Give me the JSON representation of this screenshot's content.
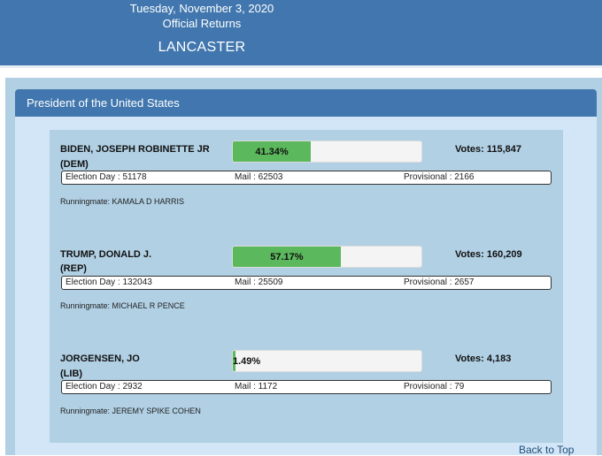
{
  "banner": {
    "date": "Tuesday, November 3, 2020",
    "returns": "Official Returns",
    "county": "LANCASTER"
  },
  "contest": {
    "title": "President of the United States"
  },
  "candidates": [
    {
      "name": "BIDEN, JOSEPH ROBINETTE JR",
      "party": "(DEM)",
      "percent": 41.34,
      "percent_label": "41.34%",
      "votes": "Votes: 115,847",
      "election_day": "Election Day : 51178",
      "mail": "Mail : 62503",
      "provisional": "Provisional : 2166",
      "runningmate": "Runningmate: KAMALA D HARRIS"
    },
    {
      "name": "TRUMP, DONALD J.",
      "party": "(REP)",
      "percent": 57.17,
      "percent_label": "57.17%",
      "votes": "Votes: 160,209",
      "election_day": "Election Day : 132043",
      "mail": "Mail : 25509",
      "provisional": "Provisional : 2657",
      "runningmate": "Runningmate: MICHAEL R PENCE"
    },
    {
      "name": "JORGENSEN, JO",
      "party": "(LIB)",
      "percent": 1.49,
      "percent_label": "1.49%",
      "votes": "Votes: 4,183",
      "election_day": "Election Day : 2932",
      "mail": "Mail : 1172",
      "provisional": "Provisional : 79",
      "runningmate": "Runningmate: JEREMY SPIKE COHEN"
    }
  ],
  "footer": {
    "back_to_top": "Back to Top"
  },
  "colors": {
    "header_blue": "#4177ae",
    "bar_green": "#5cb85c",
    "panel_blue": "#b1d0e4"
  }
}
